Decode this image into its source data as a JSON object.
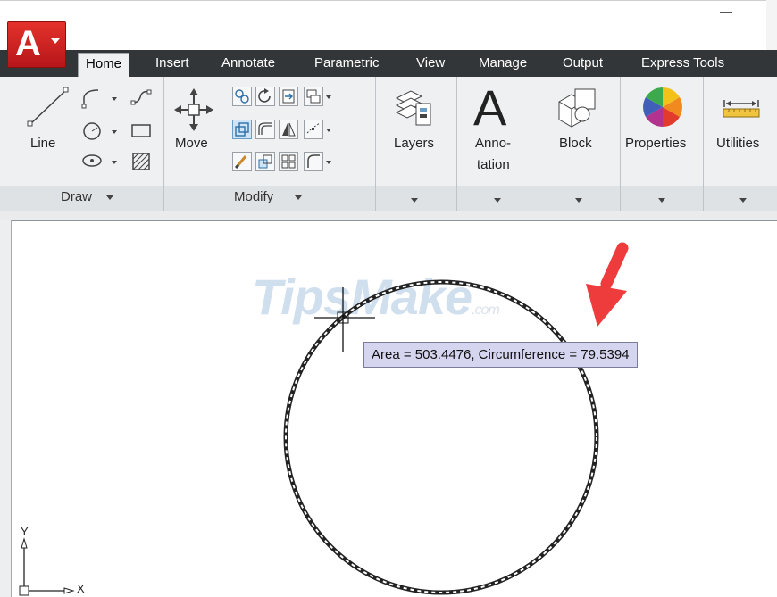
{
  "ribbon_tabs": [
    "Home",
    "Insert",
    "Annotate",
    "Parametric",
    "View",
    "Manage",
    "Output",
    "Express Tools"
  ],
  "draw_panel": {
    "title": "Draw",
    "line_label": "Line"
  },
  "modify_panel": {
    "title": "Modify",
    "move_label": "Move"
  },
  "big_buttons": {
    "layers": "Layers",
    "annotation_line1": "Anno-",
    "annotation_line2": "tation",
    "block": "Block",
    "properties": "Properties",
    "utilities": "Utilities"
  },
  "icons": {
    "app_logo": "A",
    "annotation_glyph": "A"
  },
  "tooltip": "Area = 503.4476, Circumference = 79.5394",
  "watermark": {
    "main": "TipsMake",
    "suffix": ".com"
  },
  "ucs": {
    "y": "Y",
    "x": "X"
  },
  "colors": {
    "arrow": "#ee3b3b",
    "tooltip_bg": "#d5d5f0",
    "tab_bar": "#333638"
  }
}
